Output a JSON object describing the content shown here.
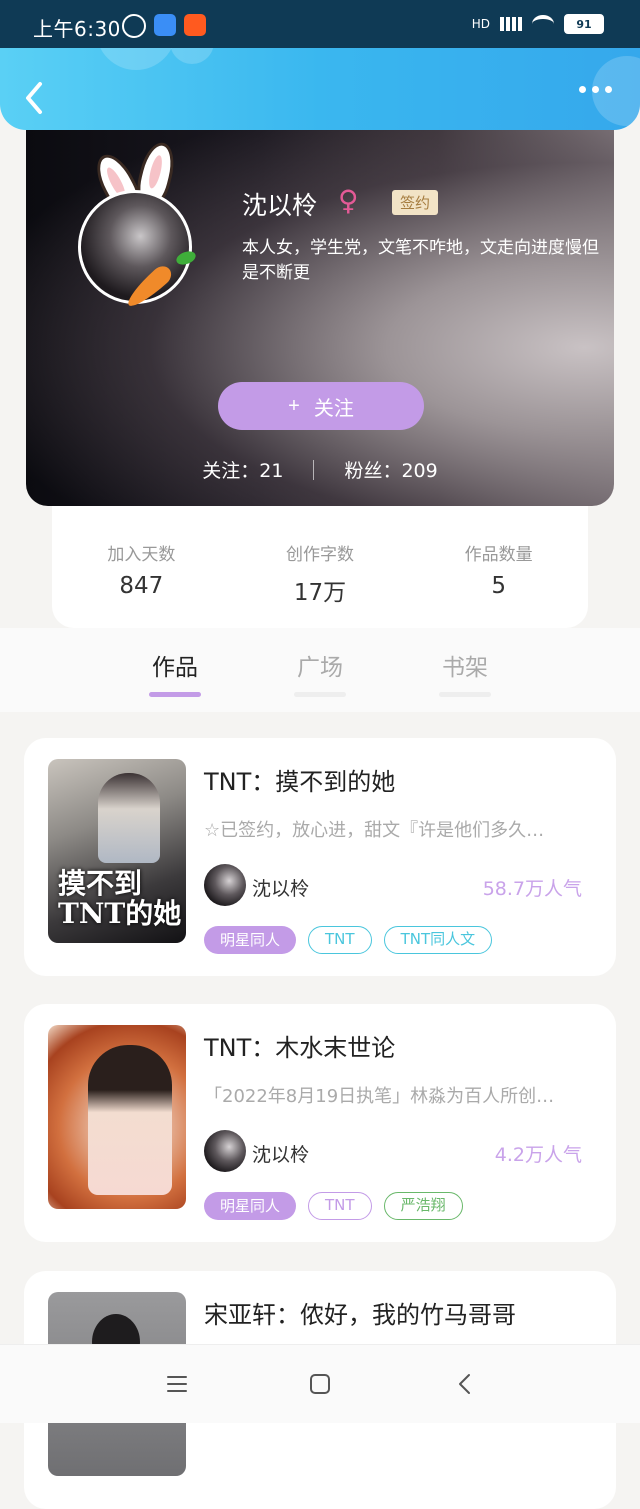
{
  "status_bar": {
    "time": "上午6:30",
    "battery": "91",
    "network": "HD"
  },
  "header": {
    "back_icon": "chevron-left-icon",
    "more_icon": "more-horizontal-icon"
  },
  "profile": {
    "name": "沈以柃",
    "gender_symbol": "♀",
    "badge": "签约",
    "bio": "本人女，学生党，文笔不咋地，文走向进度慢但是不断更",
    "follow_button": "关注",
    "follow_plus": "+",
    "following_label": "关注：21",
    "followers_label": "粉丝：209"
  },
  "stats": [
    {
      "label": "加入天数",
      "value": "847"
    },
    {
      "label": "创作字数",
      "value": "17万"
    },
    {
      "label": "作品数量",
      "value": "5"
    }
  ],
  "tabs": [
    {
      "label": "作品",
      "active": true
    },
    {
      "label": "广场",
      "active": false
    },
    {
      "label": "书架",
      "active": false
    }
  ],
  "books": [
    {
      "title": "TNT：摸不到的她",
      "cover_text": "摸不到\nTNT的她",
      "desc": "☆已签约，放心进，甜文『许是他们多久…",
      "author": "沈以柃",
      "popularity": "58.7万人气",
      "tags": [
        {
          "label": "明星同人",
          "style": "fill"
        },
        {
          "label": "TNT",
          "style": "cyan"
        },
        {
          "label": "TNT同人文",
          "style": "cyan"
        }
      ]
    },
    {
      "title": "TNT：木水末世论",
      "cover_text": "",
      "desc": "「2022年8月19日执笔」林淼为百人所创…",
      "author": "沈以柃",
      "popularity": "4.2万人气",
      "tags": [
        {
          "label": "明星同人",
          "style": "fill"
        },
        {
          "label": "TNT",
          "style": "purple"
        },
        {
          "label": "严浩翔",
          "style": "green"
        }
      ]
    },
    {
      "title": "宋亚轩：侬好，我的竹马哥哥"
    }
  ],
  "colors": {
    "accent": "#c39be7",
    "header_blue": "#3ab7ef",
    "tag_cyan": "#4ac6dd",
    "tag_green": "#69b86a"
  }
}
